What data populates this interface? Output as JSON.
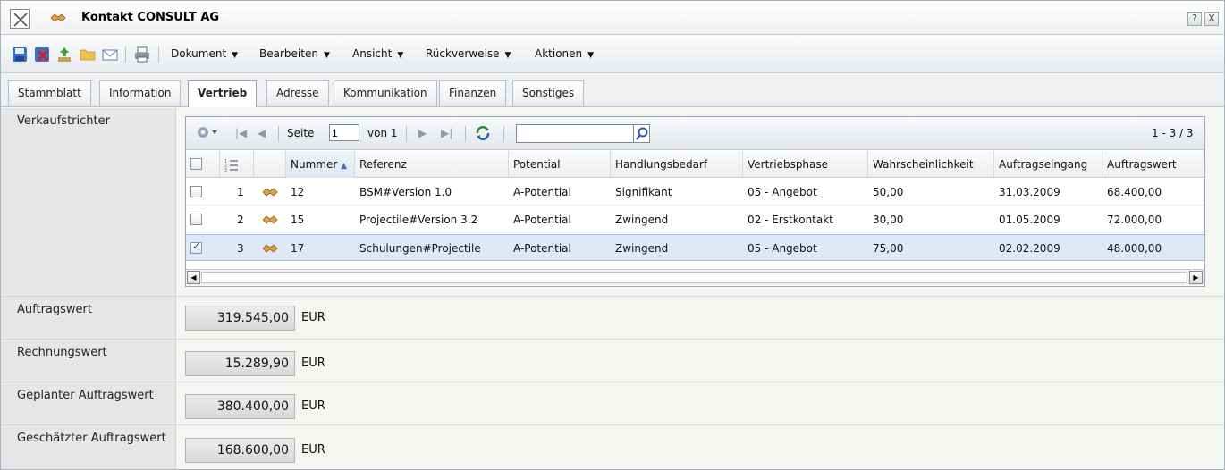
{
  "window": {
    "title": "Kontakt CONSULT AG",
    "help_label": "?",
    "close_label": "X"
  },
  "toolbar": {
    "menus": [
      {
        "label": "Dokument"
      },
      {
        "label": "Bearbeiten"
      },
      {
        "label": "Ansicht"
      },
      {
        "label": "Rückverweise"
      },
      {
        "label": "Aktionen"
      }
    ]
  },
  "tabs": [
    {
      "label": "Stammblatt",
      "active": false
    },
    {
      "label": "Information",
      "active": false
    },
    {
      "label": "Vertrieb",
      "active": true
    },
    {
      "label": "Adresse",
      "active": false
    },
    {
      "label": "Kommunikation",
      "active": false
    },
    {
      "label": "Finanzen",
      "active": false
    },
    {
      "label": "Sonstiges",
      "active": false
    }
  ],
  "form": {
    "funnel_label": "Verkaufstrichter",
    "fields": [
      {
        "label": "Auftragswert",
        "value": "319.545,00",
        "currency": "EUR"
      },
      {
        "label": "Rechnungswert",
        "value": "15.289,90",
        "currency": "EUR"
      },
      {
        "label": "Geplanter Auftragswert",
        "value": "380.400,00",
        "currency": "EUR"
      },
      {
        "label": "Geschätzter Auftragswert",
        "value": "168.600,00",
        "currency": "EUR"
      }
    ]
  },
  "grid": {
    "pager": {
      "page_label": "Seite",
      "page_value": "1",
      "of_label": "von 1",
      "range_label": "1 - 3 / 3"
    },
    "search_value": "",
    "columns": [
      "Nummer",
      "Referenz",
      "Potential",
      "Handlungsbedarf",
      "Vertriebsphase",
      "Wahrscheinlichkeit",
      "Auftragseingang",
      "Auftragswert"
    ],
    "rows": [
      {
        "index": "1",
        "checked": false,
        "selected": false,
        "nummer": "12",
        "referenz": "BSM#Version 1.0",
        "potential": "A-Potential",
        "handlungsbedarf": "Signifikant",
        "vertriebsphase": "05 - Angebot",
        "wahrscheinlichkeit": "50,00",
        "auftragseingang": "31.03.2009",
        "auftragswert": "68.400,00"
      },
      {
        "index": "2",
        "checked": false,
        "selected": false,
        "nummer": "15",
        "referenz": "Projectile#Version 3.2",
        "potential": "A-Potential",
        "handlungsbedarf": "Zwingend",
        "vertriebsphase": "02 - Erstkontakt",
        "wahrscheinlichkeit": "30,00",
        "auftragseingang": "01.05.2009",
        "auftragswert": "72.000,00"
      },
      {
        "index": "3",
        "checked": true,
        "selected": true,
        "nummer": "17",
        "referenz": "Schulungen#Projectile",
        "potential": "A-Potential",
        "handlungsbedarf": "Zwingend",
        "vertriebsphase": "05 - Angebot",
        "wahrscheinlichkeit": "75,00",
        "auftragseingang": "02.02.2009",
        "auftragswert": "48.000,00"
      }
    ]
  },
  "colors": {
    "selected_row": "#dfe8f6",
    "label_bg": "#e6e6e6",
    "field_bg": "#dedede"
  }
}
